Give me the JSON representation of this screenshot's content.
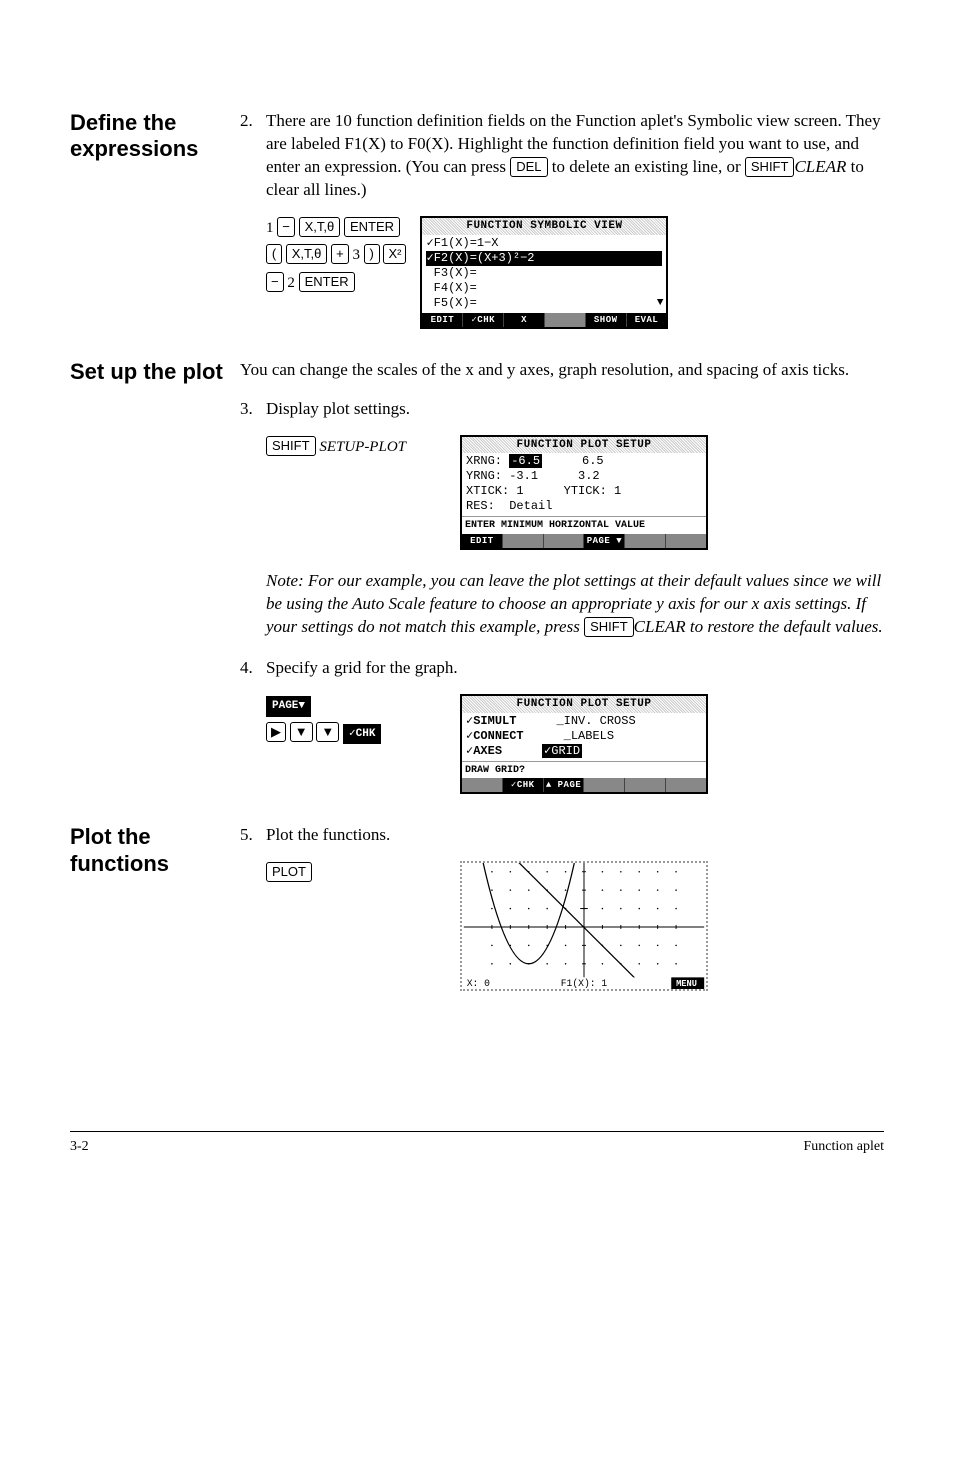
{
  "sections": {
    "define": {
      "heading": "Define the expressions",
      "step_num": "2.",
      "para_a": "There are 10 function definition fields on the Function aplet's Symbolic view screen. They are labeled F1(X) to F0(X). Highlight the function definition field you want to use, and enter an expression. (You can press ",
      "key_del": "DEL",
      "para_b": " to delete an existing line, or ",
      "key_shift": "SHIFT",
      "label_clear": "CLEAR",
      "para_c": " to clear all lines.)",
      "keyseq": {
        "l1_1": "1",
        "l1_minus": "−",
        "l1_xtt": "X,T,θ",
        "l1_enter": "ENTER",
        "l2_lp": "(",
        "l2_xtt": "X,T,θ",
        "l2_plus": "+",
        "l2_3": "3",
        "l2_rp": ")",
        "l2_x2": "X²",
        "l3_minus": "−",
        "l3_2": "2",
        "l3_enter": "ENTER"
      },
      "screen1": {
        "title": "FUNCTION SYMBOLIC VIEW",
        "l1": "✓F1(X)=1−X",
        "l2": "✓F2(X)=(X+3)²−2",
        "l3": " F3(X)=",
        "l4": " F4(X)=",
        "l5": " F5(X)=",
        "sk": [
          "EDIT",
          "✓CHK",
          "X",
          "",
          "SHOW",
          "EVAL"
        ]
      }
    },
    "setup": {
      "heading": "Set up the plot",
      "intro": "You can change the scales of the x and y axes, graph resolution, and spacing of axis ticks.",
      "step3_num": "3.",
      "step3_text": "Display plot settings.",
      "key_shift": "SHIFT",
      "label_setup_plot": "SETUP-PLOT",
      "screen2": {
        "title": "FUNCTION PLOT SETUP",
        "xrng_label": "XRNG:",
        "xrng_lo": "-6.5",
        "xrng_hi": "6.5",
        "yrng_label": "YRNG:",
        "yrng_lo": "-3.1",
        "yrng_hi": "3.2",
        "xtick_label": "XTICK:",
        "xtick": "1",
        "ytick_label": "YTICK:",
        "ytick": "1",
        "res_label": "RES:",
        "res": "Detail",
        "hint": "ENTER MINIMUM HORIZONTAL VALUE",
        "sk": [
          "EDIT",
          "",
          "",
          "PAGE ▼",
          "",
          ""
        ]
      },
      "note_a": "Note: For our example, you can leave the plot settings at their default values since we will be using the Auto Scale feature to choose an appropriate y axis for our x axis settings. If your settings do not match this example, press ",
      "note_shift": "SHIFT",
      "note_clear": "CLEAR",
      "note_b": " to restore the default values.",
      "step4_num": "4.",
      "step4_text": "Specify a grid for the graph.",
      "keyseq4": {
        "page": "PAGE▼",
        "right": "▶",
        "down1": "▼",
        "down2": "▼",
        "chk": "✓CHK"
      },
      "screen3": {
        "title": "FUNCTION PLOT SETUP",
        "simult": "✓SIMULT",
        "invcross": "_INV. CROSS",
        "connect": "✓CONNECT",
        "labels": "_LABELS",
        "axes": "✓AXES",
        "grid": "✓GRID",
        "hint": "DRAW GRID?",
        "sk": [
          "",
          "✓CHK",
          "▲ PAGE",
          "",
          "",
          ""
        ]
      }
    },
    "plot": {
      "heading": "Plot the functions",
      "step5_num": "5.",
      "step5_text": "Plot the functions.",
      "key_plot": "PLOT",
      "status_x": "X: 0",
      "status_fx": "F1(X): 1",
      "status_menu": "MENU"
    }
  },
  "footer": {
    "left": "3-2",
    "right": "Function aplet"
  },
  "chart_data": {
    "type": "line",
    "title": "",
    "xlabel": "",
    "ylabel": "",
    "xlim": [
      -6.5,
      6.5
    ],
    "ylim": [
      -3.1,
      3.2
    ],
    "xtick": 1,
    "ytick": 1,
    "grid": true,
    "series": [
      {
        "name": "F1(X)=1-X",
        "x": [
          -6.5,
          6.5
        ],
        "y": [
          7.5,
          -5.5
        ]
      },
      {
        "name": "F2(X)=(X+3)^2-2",
        "x": [
          -6.5,
          -6,
          -5.5,
          -5,
          -4.5,
          -4,
          -3.5,
          -3,
          -2.5,
          -2,
          -1.5,
          -1,
          -0.5,
          0,
          0.5
        ],
        "y": [
          10.25,
          7,
          4.25,
          2,
          0.25,
          -1,
          -1.75,
          -2,
          -1.75,
          -1,
          0.25,
          2,
          4.25,
          7,
          10.25
        ]
      }
    ],
    "cursor": {
      "x": 0,
      "fx": 1
    }
  }
}
